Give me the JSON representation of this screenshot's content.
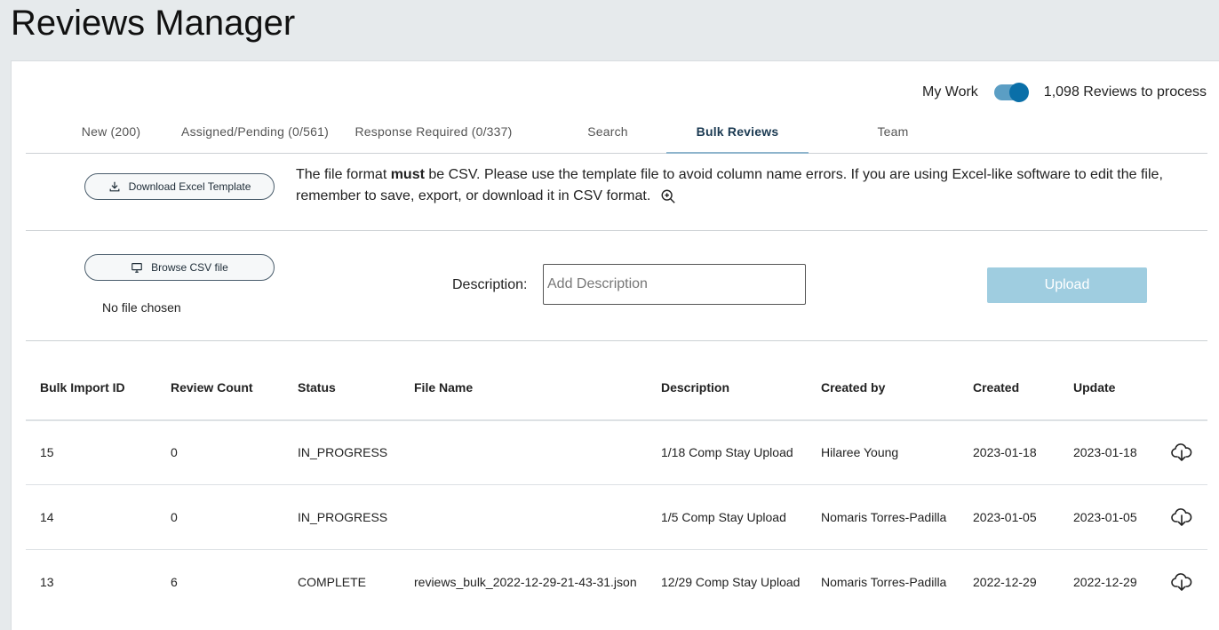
{
  "page_title": "Reviews Manager",
  "my_work": {
    "label": "My Work",
    "toggle_on": true,
    "reviews_to_process": "1,098 Reviews to process"
  },
  "tabs": [
    {
      "label": "New (200)"
    },
    {
      "label": "Assigned/Pending (0/561)"
    },
    {
      "label": "Response Required (0/337)"
    },
    {
      "label": "Search"
    },
    {
      "label": "Bulk Reviews",
      "active": true
    },
    {
      "label": "Team"
    }
  ],
  "download_template": {
    "label": "Download Excel Template",
    "icon": "download-icon"
  },
  "info": {
    "prefix": "The file format ",
    "bold": "must",
    "suffix": " be CSV. Please use the template file to avoid column name errors. If you are using Excel-like software to edit the file, remember to save, export, or download it in CSV format."
  },
  "browse": {
    "label": "Browse CSV file",
    "icon": "monitor-icon",
    "no_file": "No file chosen"
  },
  "description": {
    "label": "Description:",
    "placeholder": "Add Description",
    "value": ""
  },
  "upload": {
    "label": "Upload"
  },
  "table": {
    "headers": [
      "Bulk Import ID",
      "Review Count",
      "Status",
      "File Name",
      "Description",
      "Created by",
      "Created",
      "Update"
    ],
    "rows": [
      {
        "id": "15",
        "count": "0",
        "status": "IN_PROGRESS",
        "file": "",
        "description": "1/18 Comp Stay Upload",
        "created_by": "Hilaree Young",
        "created": "2023-01-18",
        "update": "2023-01-18"
      },
      {
        "id": "14",
        "count": "0",
        "status": "IN_PROGRESS",
        "file": "",
        "description": "1/5 Comp Stay Upload",
        "created_by": "Nomaris Torres-Padilla",
        "created": "2023-01-05",
        "update": "2023-01-05"
      },
      {
        "id": "13",
        "count": "6",
        "status": "COMPLETE",
        "file": "reviews_bulk_2022-12-29-21-43-31.json",
        "description": "12/29 Comp Stay Upload",
        "created_by": "Nomaris Torres-Padilla",
        "created": "2022-12-29",
        "update": "2022-12-29"
      }
    ]
  },
  "colors": {
    "background": "#e6eaec",
    "accent": "#0a6fa8",
    "upload_disabled": "#9fcde0",
    "active_tab": "#1b3a52"
  }
}
